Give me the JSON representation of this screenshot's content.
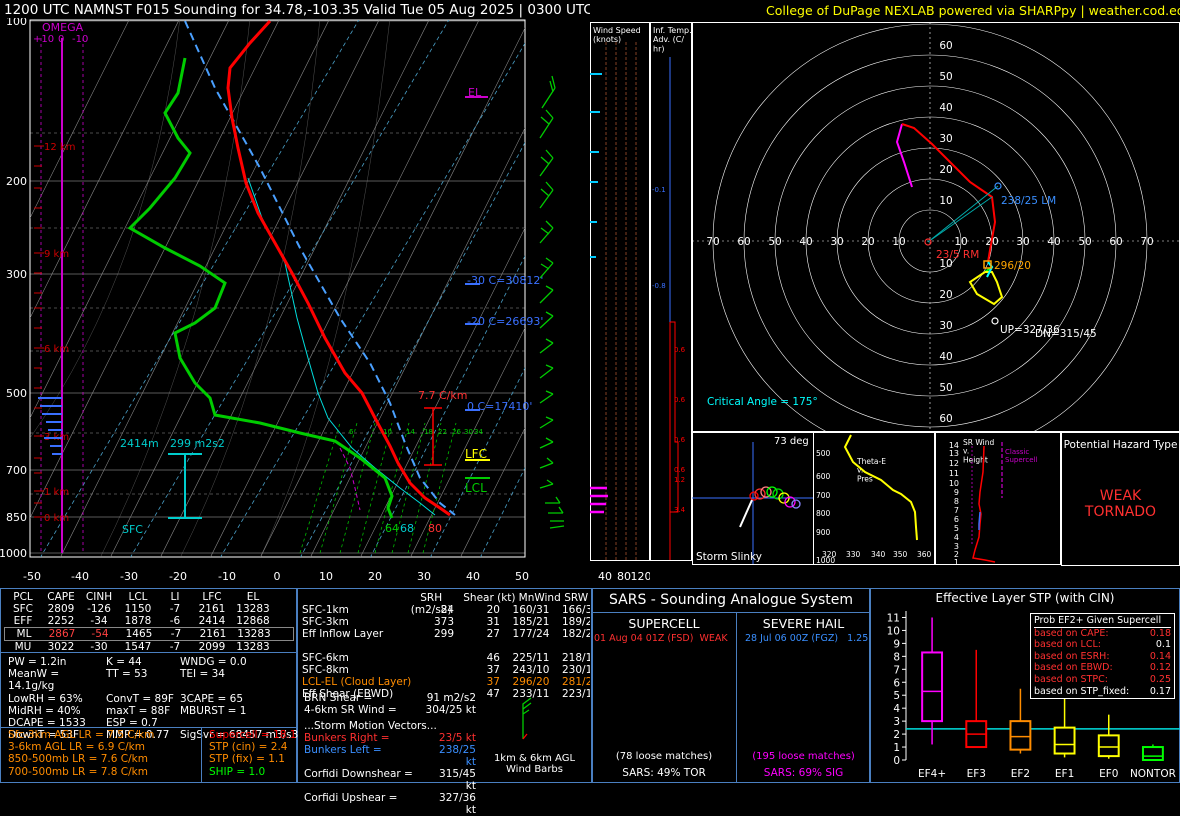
{
  "header": {
    "title": "1200 UTC NAMNST F015 Sounding for 34.78,-103.35 Valid  Tue 05 Aug 2025 | 0300 UTC",
    "credit": "College of DuPage NEXLAB powered via SHARPpy | weather.cod.edu"
  },
  "skewt": {
    "pressure_ticks": [
      "100",
      "200",
      "300",
      "500",
      "700",
      "850",
      "1000"
    ],
    "temp_ticks": [
      "-50",
      "-40",
      "-30",
      "-20",
      "-10",
      "0",
      "10",
      "20",
      "30",
      "40",
      "50"
    ],
    "omega_label": "OMEGA",
    "omega_scale": [
      "+10",
      "0",
      "-10"
    ],
    "height_labels": [
      "12 km",
      "9 km",
      "6 km",
      "3 km",
      "1 km",
      "0 km"
    ],
    "el": "EL",
    "lfc": "LFC",
    "lcl": "LCL",
    "lapse_rate": "7.7 C/km",
    "hgz": [
      "-30 C=30812'",
      "-20 C=26693'",
      "0 C=17410'"
    ],
    "eil_depth": "2414m",
    "eil_srh": "299 m2s2",
    "sfc": "SFC",
    "td_sfc": "64",
    "tw_sfc": "68",
    "t_sfc": "80",
    "mixing_ratios": [
      "6",
      "10",
      "14",
      "18",
      "22",
      "26",
      "30",
      "34"
    ]
  },
  "wind_speed": {
    "title": "Wind Speed\n(knots)",
    "ticks": [
      "40",
      "80",
      "120"
    ]
  },
  "inf_temp": {
    "title": "Inf. Temp.\nAdv. (C/\nhr)",
    "values": [
      "-0.1",
      "-0.8",
      "0.6",
      "0.6",
      "0.6",
      "0.6",
      "1.2",
      "3.4"
    ]
  },
  "hodograph": {
    "rings": [
      "10",
      "20",
      "30",
      "40",
      "50",
      "60",
      "70"
    ],
    "lm": "238/25 LM",
    "rm": "23/5 RM",
    "mean": "296/20",
    "up": "UP=327/36",
    "dn": "DN=315/45",
    "critical_angle": "Critical Angle = 175°"
  },
  "slinky": {
    "deg": "73 deg",
    "label": "Storm Slinky"
  },
  "theta": {
    "label": "Theta-E\nv.\nPres",
    "yticks": [
      "500",
      "600",
      "700",
      "800",
      "900",
      "1000"
    ],
    "xticks": [
      "320",
      "330",
      "340",
      "350",
      "360"
    ]
  },
  "srwind": {
    "label": "SR Wind\nv.\nHeight",
    "classic": "Classic\nSupercell",
    "yticks": [
      "14",
      "13",
      "12",
      "11",
      "10",
      "9",
      "8",
      "7",
      "6",
      "5",
      "4",
      "3",
      "2",
      "1",
      "0"
    ]
  },
  "hazard": {
    "title": "Potential Hazard Type",
    "value": "WEAK\nTORNADO"
  },
  "parcels": {
    "headers": [
      "PCL",
      "CAPE",
      "CINH",
      "LCL",
      "LI",
      "LFC",
      "EL"
    ],
    "rows": [
      [
        "SFC",
        "2809",
        "-126",
        "1150",
        "-7",
        "2161",
        "13283"
      ],
      [
        "EFF",
        "2252",
        "-34",
        "1878",
        "-6",
        "2414",
        "12868"
      ],
      [
        "ML",
        "2867",
        "-54",
        "1465",
        "-7",
        "2161",
        "13283"
      ],
      [
        "MU",
        "3022",
        "-30",
        "1547",
        "-7",
        "2099",
        "13283"
      ]
    ]
  },
  "indices": [
    [
      "PW = 1.2in",
      "K = 44",
      "WNDG = 0.0"
    ],
    [
      "MeanW = 14.1g/kg",
      "TT = 53",
      "TEI = 34"
    ],
    [
      "LowRH = 63%",
      "ConvT = 89F",
      "3CAPE = 65"
    ],
    [
      "MidRH = 40%",
      "maxT = 88F",
      "MBURST = 1"
    ],
    [
      "DCAPE = 1533",
      "ESP = 0.7",
      ""
    ],
    [
      "DownT = 53F",
      "MMP = 0.77",
      "SigSvr = 68457 m3/s3"
    ]
  ],
  "lapse": [
    "Sfc-3km AGL LR = 7.5 C/km",
    "3-6km AGL LR = 6.9 C/km",
    "850-500mb LR = 7.6 C/km",
    "700-500mb LR = 7.8 C/km"
  ],
  "composite": [
    "Supercell = 18.1",
    "STP (cin) = 2.4",
    "STP (fix) = 1.1",
    "SHIP = 1.0"
  ],
  "kinematics": {
    "headers": [
      "SRH (m2/s2)",
      "Shear (kt)",
      "MnWind",
      "SRW"
    ],
    "rows": [
      [
        "SFC-1km",
        "84",
        "20",
        "160/31",
        "166/35"
      ],
      [
        "SFC-3km",
        "373",
        "31",
        "185/21",
        "189/27"
      ],
      [
        "Eff Inflow Layer",
        "299",
        "27",
        "177/24",
        "182/29"
      ],
      [
        "",
        "",
        "",
        "",
        ""
      ],
      [
        "SFC-6km",
        "",
        "46",
        "225/11",
        "218/17"
      ],
      [
        "SFC-8km",
        "",
        "37",
        "243/10",
        "230/15"
      ],
      [
        "LCL-EL (Cloud Layer)",
        "",
        "37",
        "296/20",
        "281/20"
      ],
      [
        "Eff Shear (EBWD)",
        "",
        "47",
        "233/11",
        "223/16"
      ]
    ],
    "brn": "BRN Shear =",
    "brn_val": "91 m2/s2",
    "srw46": "4-6km SR Wind =",
    "srw46_val": "304/25 kt",
    "storm_header": "...Storm Motion Vectors...",
    "vectors": [
      [
        "Bunkers Right =",
        "23/5 kt"
      ],
      [
        "Bunkers Left =",
        "238/25 kt"
      ],
      [
        "Corfidi Downshear =",
        "315/45 kt"
      ],
      [
        "Corfidi Upshear =",
        "327/36 kt"
      ]
    ],
    "barbs": "1km & 6km AGL\nWind Barbs"
  },
  "sars": {
    "title": "SARS - Sounding Analogue System",
    "supercell": "SUPERCELL",
    "hail": "SEVERE HAIL",
    "sc_match": "01 Aug 04 01Z (FSD)  WEAK",
    "hail_match": "28 Jul 06 00Z (FGZ)   1.25",
    "sc_loose": "(78 loose matches)",
    "hail_loose": "(195 loose matches)",
    "sc_pct": "SARS: 49% TOR",
    "hail_pct": "SARS: 69% SIG"
  },
  "stp": {
    "title": "Effective Layer STP (with CIN)",
    "yticks": [
      "11",
      "10",
      "9",
      "8",
      "7",
      "6",
      "5",
      "4",
      "3",
      "2",
      "1",
      "0"
    ],
    "categories": [
      "EF4+",
      "EF3",
      "EF2",
      "EF1",
      "EF0",
      "NONTOR"
    ],
    "prob_title": "Prob EF2+ Given Supercell",
    "probs": [
      [
        "based on CAPE:",
        "0.18"
      ],
      [
        "based on LCL:",
        "0.1"
      ],
      [
        "based on ESRH:",
        "0.14"
      ],
      [
        "based on EBWD:",
        "0.12"
      ],
      [
        "based on STPC:",
        "0.25"
      ],
      [
        "based on STP_fixed:",
        "0.17"
      ]
    ]
  },
  "chart_data": {
    "type": "box",
    "title": "Effective Layer STP (with CIN)",
    "categories": [
      "EF4+",
      "EF3",
      "EF2",
      "EF1",
      "EF0",
      "NONTOR"
    ],
    "boxes": [
      {
        "min": 1.2,
        "q1": 3.0,
        "median": 5.3,
        "q3": 8.3,
        "max": 11.0
      },
      {
        "min": 1.0,
        "q1": 1.0,
        "median": 2.0,
        "q3": 3.0,
        "max": 8.5
      },
      {
        "min": 0.5,
        "q1": 0.8,
        "median": 1.8,
        "q3": 3.0,
        "max": 5.5
      },
      {
        "min": 0.2,
        "q1": 0.5,
        "median": 1.2,
        "q3": 2.5,
        "max": 4.8
      },
      {
        "min": 0.1,
        "q1": 0.3,
        "median": 1.0,
        "q3": 1.9,
        "max": 3.5
      },
      {
        "min": 0.0,
        "q1": 0.0,
        "median": 0.3,
        "q3": 1.0,
        "max": 1.2
      }
    ],
    "colors": [
      "#ff00ff",
      "#ff0000",
      "#ff8c00",
      "#ffff00",
      "#ffff00",
      "#00ff00"
    ],
    "current_value": 2.4,
    "ylim": [
      0,
      11.5
    ]
  }
}
